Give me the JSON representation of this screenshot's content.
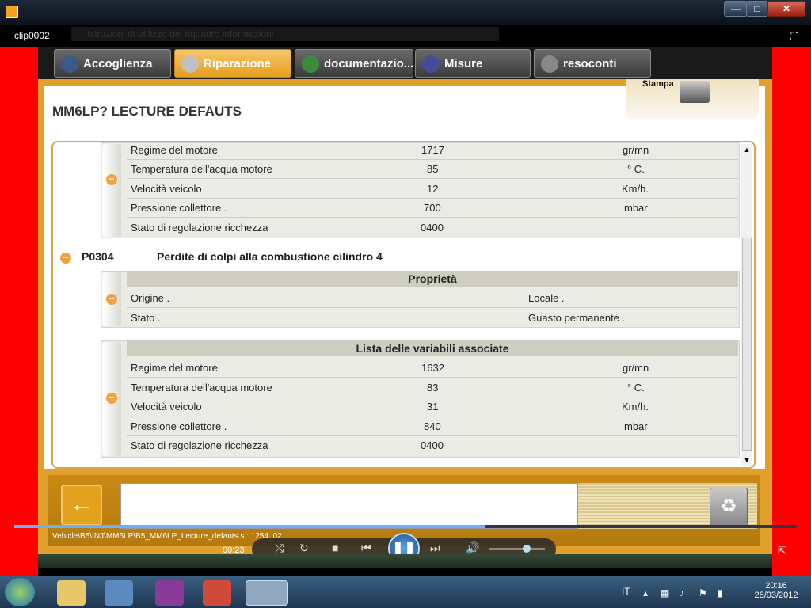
{
  "window": {
    "minimize": "—",
    "maximize": "□",
    "close": "✕",
    "clip_name": "clip0002",
    "ghost_text": "Istruzioni di utilizzo del riquadro informazioni"
  },
  "tabs": [
    {
      "label": "Accoglienza",
      "icon": "home-gear-icon"
    },
    {
      "label": "Riparazione",
      "icon": "magnifier-icon"
    },
    {
      "label": "documentazio...",
      "icon": "book-icon"
    },
    {
      "label": "Misure",
      "icon": "waveform-icon"
    },
    {
      "label": "resoconti",
      "icon": "report-icon"
    }
  ],
  "page": {
    "title": "MM6LP?  LECTURE DEFAUTS",
    "stampa": "Stampa"
  },
  "group1": {
    "rows": [
      {
        "name": "Regime del motore",
        "value": "1717",
        "unit": "gr/mn"
      },
      {
        "name": "Temperatura dell'acqua motore",
        "value": "85",
        "unit": "° C."
      },
      {
        "name": "Velocità veicolo",
        "value": "12",
        "unit": "Km/h."
      },
      {
        "name": "Pressione collettore .",
        "value": "700",
        "unit": "mbar"
      },
      {
        "name": "Stato di regolazione ricchezza",
        "value": "0400",
        "unit": ""
      }
    ]
  },
  "fault": {
    "code": "P0304",
    "description": "Perdite di colpi alla combustione cilindro 4"
  },
  "properties": {
    "header": "Proprietà",
    "rows": [
      {
        "name": "Origine .",
        "value": "Locale ."
      },
      {
        "name": "Stato .",
        "value": "Guasto permanente ."
      }
    ]
  },
  "variables": {
    "header": "Lista delle variabili associate",
    "rows": [
      {
        "name": "Regime del motore",
        "value": "1632",
        "unit": "gr/mn"
      },
      {
        "name": "Temperatura dell'acqua motore",
        "value": "83",
        "unit": "° C."
      },
      {
        "name": "Velocità veicolo",
        "value": "31",
        "unit": "Km/h."
      },
      {
        "name": "Pressione collettore .",
        "value": "840",
        "unit": "mbar"
      },
      {
        "name": "Stato di regolazione ricchezza",
        "value": "0400",
        "unit": ""
      }
    ]
  },
  "bottom": {
    "path": "Vehicle\\B5\\INJ\\MM6LP\\B5_MM6LP_Lecture_defauts.s : 1254_02",
    "back": "←",
    "trash": "♻"
  },
  "player": {
    "time": "00:23",
    "progress": 0.6
  },
  "taskbar": {
    "lang": "IT",
    "time": "20:16",
    "date": "28/03/2012"
  },
  "colors": {
    "accent": "#e0a02a",
    "frame_red": "#ff0000",
    "minus": "#f5a041"
  }
}
